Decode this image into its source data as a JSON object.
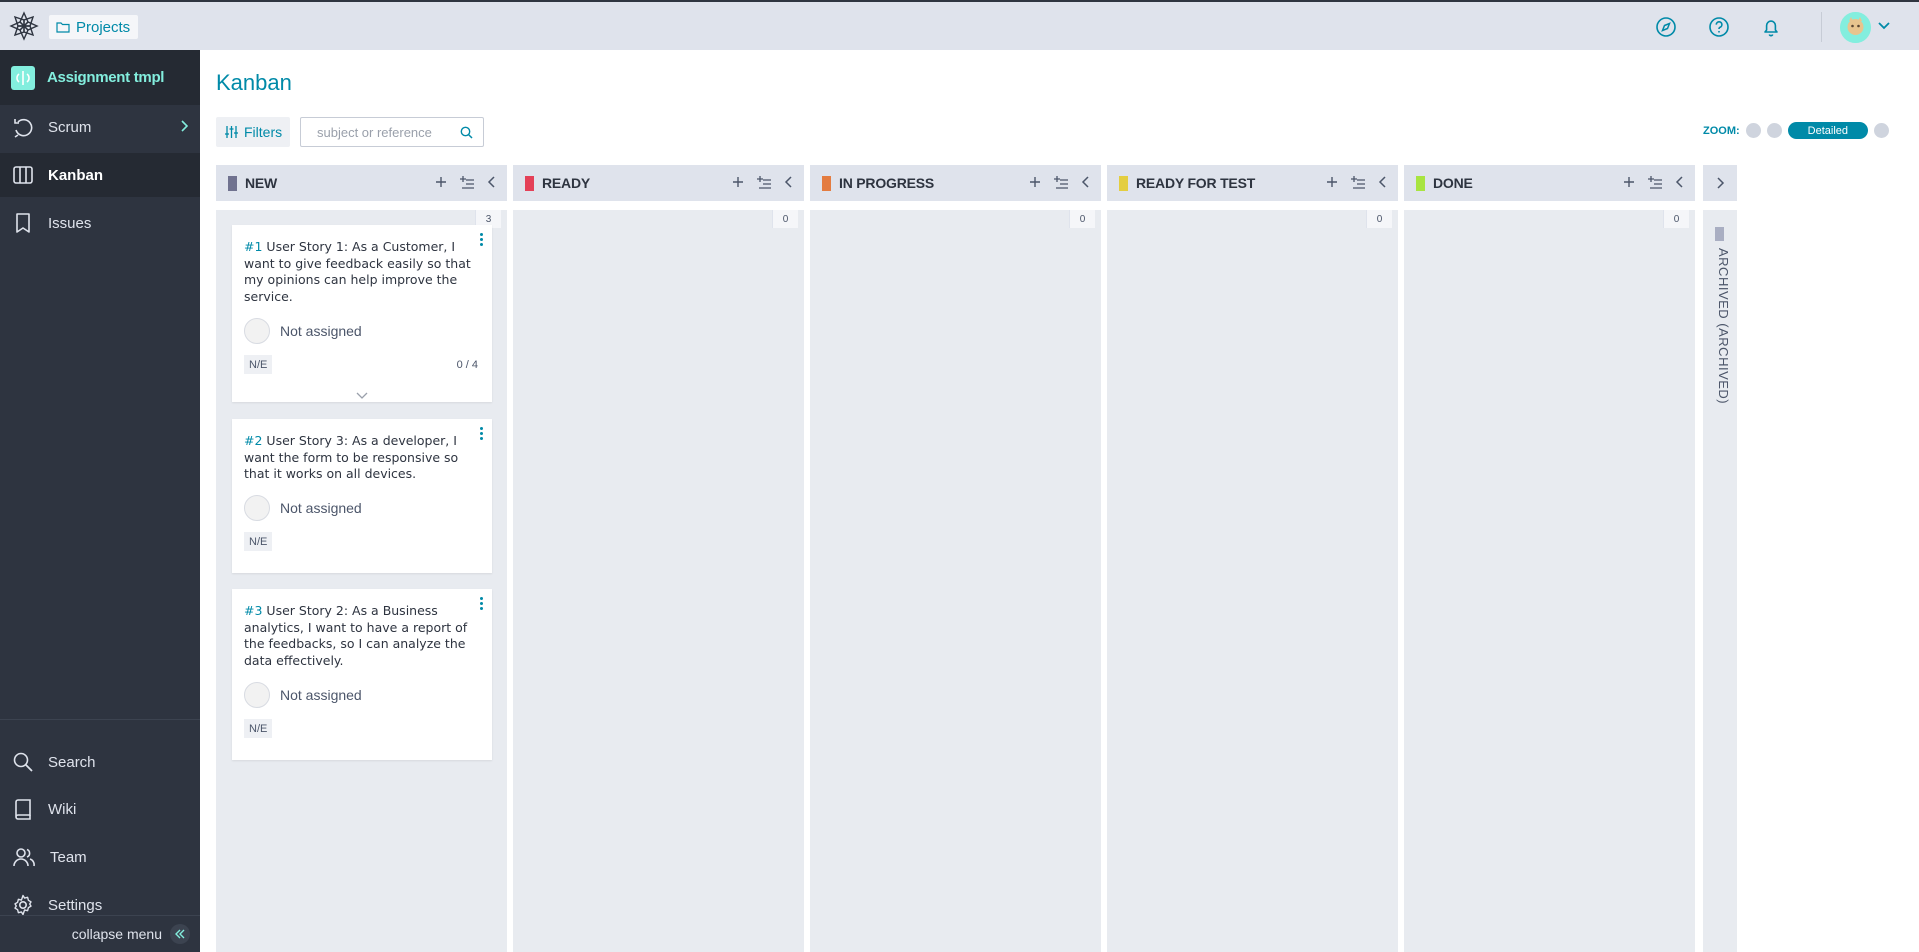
{
  "topbar": {
    "projects_label": "Projects",
    "icons": [
      "discover-icon",
      "help-icon",
      "notifications-icon"
    ]
  },
  "sidebar": {
    "project_name": "Assignment tmpl",
    "items": [
      {
        "label": "Scrum",
        "icon": "scrum-icon"
      },
      {
        "label": "Kanban",
        "icon": "kanban-icon"
      },
      {
        "label": "Issues",
        "icon": "issues-icon"
      },
      {
        "label": "Search",
        "icon": "search-icon"
      },
      {
        "label": "Wiki",
        "icon": "wiki-icon"
      },
      {
        "label": "Team",
        "icon": "team-icon"
      },
      {
        "label": "Settings",
        "icon": "settings-icon"
      }
    ],
    "collapse_label": "collapse menu"
  },
  "main": {
    "title": "Kanban",
    "filters_label": "Filters",
    "search_placeholder": "subject or reference",
    "zoom_label": "ZOOM:",
    "zoom_selected": "Detailed"
  },
  "columns": [
    {
      "name": "NEW",
      "color": "#70728f",
      "count": "3"
    },
    {
      "name": "READY",
      "color": "#e44057",
      "count": "0"
    },
    {
      "name": "IN PROGRESS",
      "color": "#e47c40",
      "count": "0"
    },
    {
      "name": "READY FOR TEST",
      "color": "#e4ce40",
      "count": "0"
    },
    {
      "name": "DONE",
      "color": "#a8e440",
      "count": "0"
    }
  ],
  "archived": {
    "label": "ARCHIVED (ARCHIVED)",
    "color": "#a9aec2"
  },
  "cards": [
    {
      "ref": "#1",
      "subject": "User Story 1: As a Customer, I want to give feedback easily so that my opinions can help improve the service.",
      "assignee": "Not assigned",
      "points": "N/E",
      "tasks": "0 / 4"
    },
    {
      "ref": "#2",
      "subject": "User Story 3: As a developer, I want the form to be responsive so that it works on all devices.",
      "assignee": "Not assigned",
      "points": "N/E"
    },
    {
      "ref": "#3",
      "subject": "User Story 2: As a Business analytics, I want to have a report of the feedbacks, so I can analyze the data effectively.",
      "assignee": "Not assigned",
      "points": "N/E"
    }
  ]
}
